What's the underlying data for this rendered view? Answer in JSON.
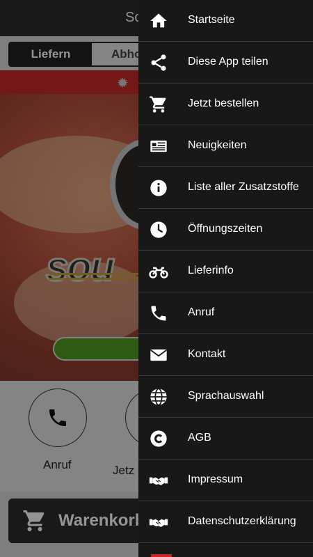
{
  "page": {
    "title_fragment": "So",
    "toggle": {
      "active": "Liefern",
      "inactive": "Abho"
    },
    "actions": [
      {
        "label": "Anruf",
        "icon": "phone-icon"
      },
      {
        "label": "Jetz",
        "icon": "cart-icon"
      }
    ],
    "cart_label": "Warenkorb",
    "colors": {
      "topbar": "#2b2b2b",
      "red_bar": "#c62828",
      "green_button": "#4f9a1e",
      "drawer": "#181818"
    }
  },
  "drawer": {
    "items": [
      {
        "label": "Startseite",
        "icon": "home-icon"
      },
      {
        "label": "Diese App teilen",
        "icon": "share-icon"
      },
      {
        "label": "Jetzt bestellen",
        "icon": "cart-icon"
      },
      {
        "label": "Neuigkeiten",
        "icon": "newspaper-icon"
      },
      {
        "label": "Liste aller Zusatzstoffe",
        "icon": "info-icon"
      },
      {
        "label": "Öffnungszeiten",
        "icon": "clock-icon"
      },
      {
        "label": "Lieferinfo",
        "icon": "motorcycle-icon"
      },
      {
        "label": "Anruf",
        "icon": "phone-icon"
      },
      {
        "label": "Kontakt",
        "icon": "envelope-icon"
      },
      {
        "label": "Sprachauswahl",
        "icon": "globe-icon"
      },
      {
        "label": "AGB",
        "icon": "copyright-icon"
      },
      {
        "label": "Impressum",
        "icon": "handshake-icon"
      },
      {
        "label": "Datenschutzerklärung",
        "icon": "handshake-icon"
      }
    ]
  }
}
